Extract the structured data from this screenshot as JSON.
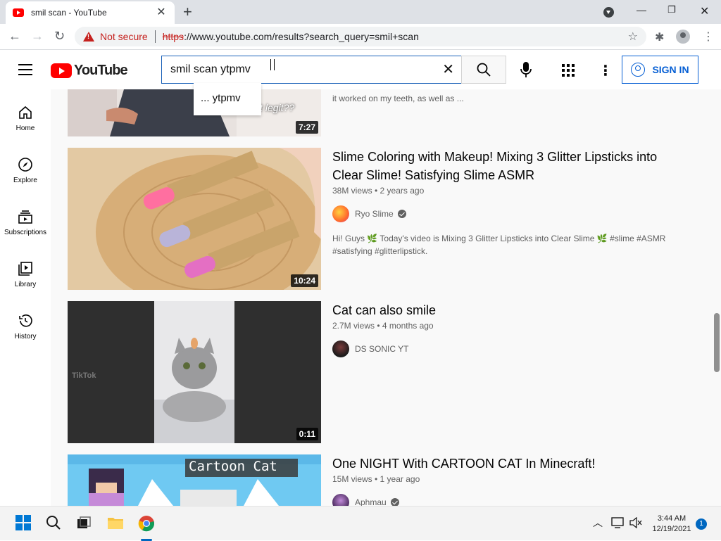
{
  "browser": {
    "tab_title": "smil scan - YouTube",
    "security_label": "Not secure",
    "url_scheme": "https",
    "url_rest": "://www.youtube.com/results?search_query=smil+scan"
  },
  "youtube": {
    "logo_text": "YouTube",
    "search_value": "smil scan ytpmv",
    "suggestion": "... ytpmv",
    "sign_in_label": "SIGN IN"
  },
  "sidebar": {
    "items": [
      {
        "label": "Home",
        "icon": "home-icon"
      },
      {
        "label": "Explore",
        "icon": "compass-icon"
      },
      {
        "label": "Subscriptions",
        "icon": "subscriptions-icon"
      },
      {
        "label": "Library",
        "icon": "library-icon"
      },
      {
        "label": "History",
        "icon": "history-icon"
      }
    ]
  },
  "results": [
    {
      "duration": "7:27",
      "thumb_text": "is it legit??",
      "description": "it worked on my teeth, as well as ..."
    },
    {
      "title_line1": "Slime Coloring with Makeup! Mixing 3 Glitter Lipsticks into",
      "title_line2": "Clear Slime! Satisfying Slime ASMR",
      "meta": "38M views • 2 years ago",
      "channel": "Ryo Slime",
      "desc_line1": "Hi! Guys 🌿 Today's video is Mixing 3 Glitter Lipsticks into Clear Slime 🌿 #slime #ASMR",
      "desc_line2": "#satisfying #glitterlipstick.",
      "duration": "10:24"
    },
    {
      "title": "Cat can also smile",
      "meta": "2.7M views • 4 months ago",
      "channel": "DS SONIC YT",
      "duration": "0:11",
      "watermark": "TikTok"
    },
    {
      "title": "One NIGHT With CARTOON CAT In Minecraft!",
      "meta": "15M views • 1 year ago",
      "channel": "Aphmau",
      "thumb_text": "Cartoon Cat"
    }
  ],
  "taskbar": {
    "time": "3:44 AM",
    "date": "12/19/2021",
    "notification_count": "1"
  },
  "colors": {
    "brand_red": "#ff0000",
    "accent_blue": "#065fd4",
    "insecure_red": "#c5221f"
  }
}
